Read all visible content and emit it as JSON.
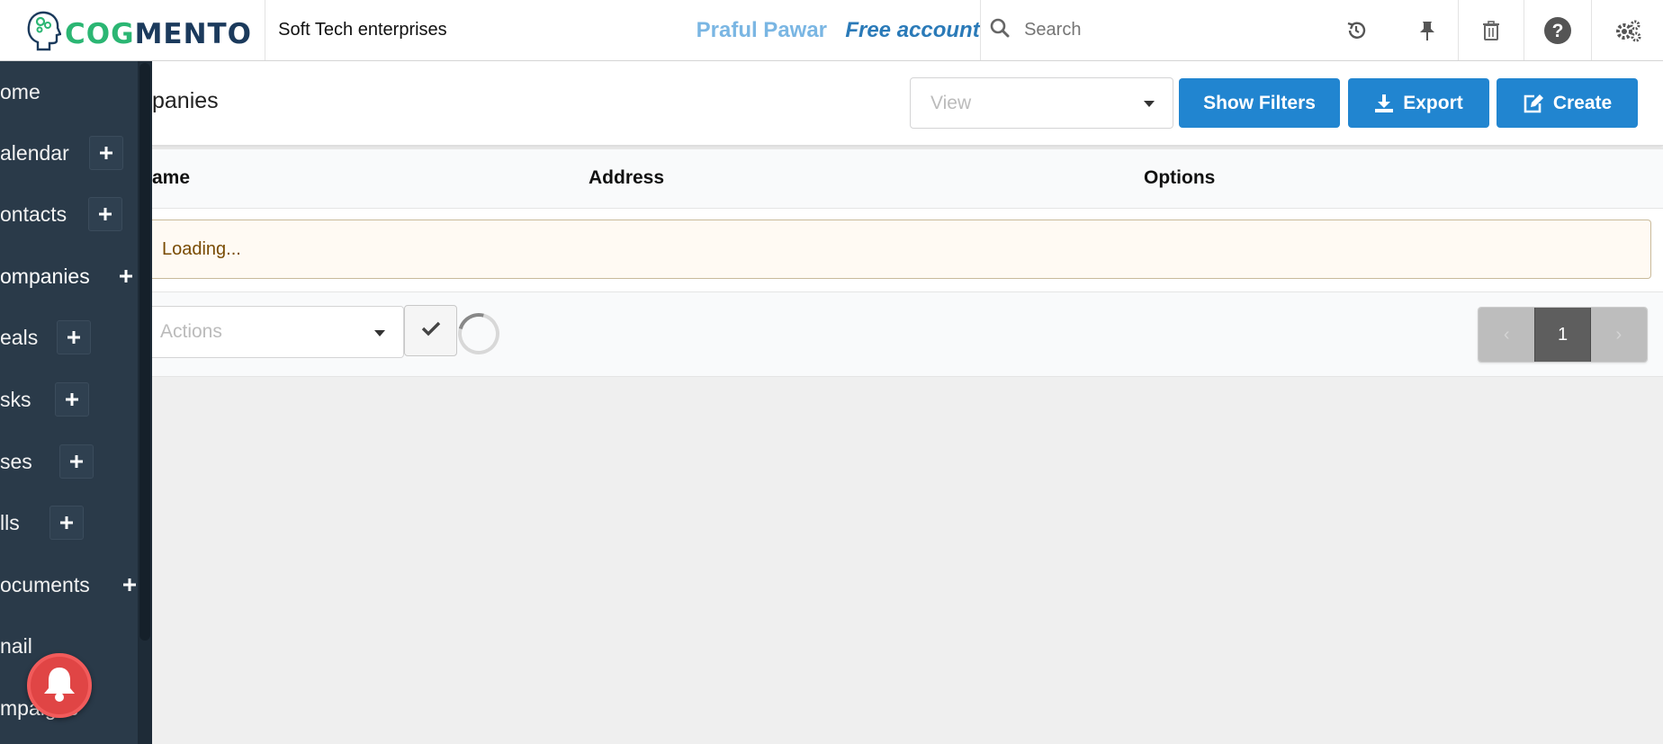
{
  "header": {
    "logo_text_primary": "COG",
    "logo_text_secondary": "MENTO",
    "company_name": "Soft Tech enterprises",
    "user_name": "Praful Pawar",
    "account_type": "Free account",
    "search_placeholder": "Search",
    "icons": [
      "history-icon",
      "pin-icon",
      "trash-icon",
      "help-icon",
      "settings-icon"
    ]
  },
  "sidebar": {
    "items": [
      {
        "label": "ome",
        "has_add": false
      },
      {
        "label": "alendar",
        "has_add": true
      },
      {
        "label": "ontacts",
        "has_add": true
      },
      {
        "label": "ompanies",
        "has_add": true,
        "active": true
      },
      {
        "label": "eals",
        "has_add": true
      },
      {
        "label": "sks",
        "has_add": true
      },
      {
        "label": "ses",
        "has_add": true
      },
      {
        "label": "lls",
        "has_add": true
      },
      {
        "label": "ocuments",
        "has_add": true
      },
      {
        "label": "nail",
        "has_add": false
      },
      {
        "label": "mpaigns",
        "has_add": false
      }
    ]
  },
  "page": {
    "title": "panies",
    "view_placeholder": "View",
    "buttons": {
      "show_filters": "Show Filters",
      "export": "Export",
      "create": "Create"
    }
  },
  "table": {
    "columns": [
      "ame",
      "Address",
      "Options"
    ],
    "loading_text": "Loading...",
    "actions_placeholder": "Actions",
    "pagination": {
      "current_page": "1",
      "prev": "‹",
      "next": "›"
    }
  },
  "colors": {
    "primary": "#2185d0",
    "sidebar_bg": "#2a3a49",
    "brand_green": "#2bb673",
    "brand_navy": "#1b3a5c",
    "notification": "#e04545"
  }
}
